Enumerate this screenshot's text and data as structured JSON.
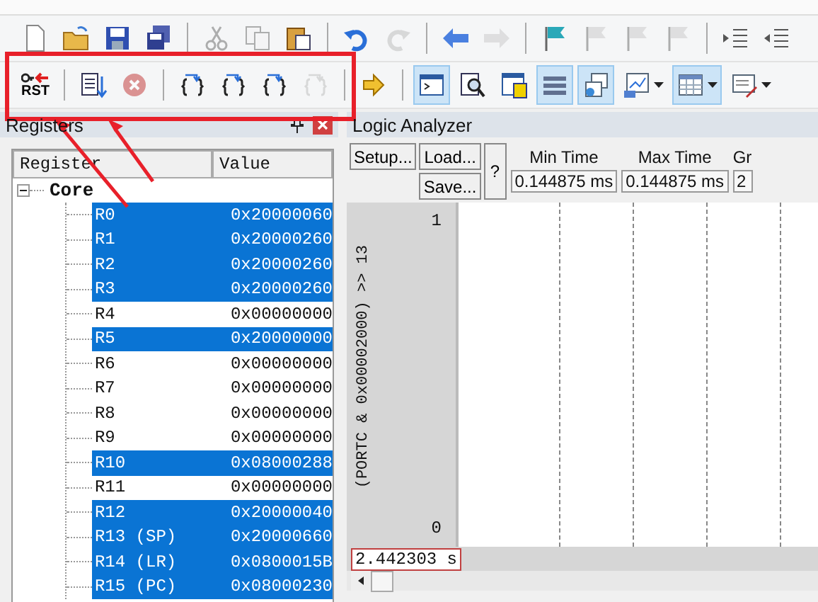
{
  "toolbar_rows": [
    [
      {
        "kind": "new",
        "disabled": false
      },
      {
        "kind": "open",
        "disabled": false
      },
      {
        "kind": "save",
        "disabled": false
      },
      {
        "kind": "saveall",
        "disabled": false
      },
      {
        "kind": "sep"
      },
      {
        "kind": "cut",
        "disabled": true
      },
      {
        "kind": "copy",
        "disabled": true
      },
      {
        "kind": "paste",
        "disabled": false
      },
      {
        "kind": "sep"
      },
      {
        "kind": "undo",
        "disabled": false
      },
      {
        "kind": "redo",
        "disabled": true
      },
      {
        "kind": "sep"
      },
      {
        "kind": "back",
        "disabled": false
      },
      {
        "kind": "forward",
        "disabled": true
      },
      {
        "kind": "sep"
      },
      {
        "kind": "flag",
        "disabled": false
      },
      {
        "kind": "flag",
        "disabled": true
      },
      {
        "kind": "flag",
        "disabled": true
      },
      {
        "kind": "flag",
        "disabled": true
      },
      {
        "kind": "sep"
      },
      {
        "kind": "indent",
        "disabled": false
      },
      {
        "kind": "outdent",
        "disabled": false
      }
    ],
    [
      {
        "kind": "rst",
        "label": "RST",
        "disabled": false
      },
      {
        "kind": "sep"
      },
      {
        "kind": "steplist",
        "disabled": false
      },
      {
        "kind": "stop",
        "disabled": true
      },
      {
        "kind": "sep"
      },
      {
        "kind": "braces",
        "disabled": false
      },
      {
        "kind": "braces",
        "disabled": false
      },
      {
        "kind": "braces",
        "disabled": false
      },
      {
        "kind": "braces",
        "disabled": true
      },
      {
        "kind": "sep"
      },
      {
        "kind": "arrow",
        "disabled": false
      },
      {
        "kind": "sep"
      },
      {
        "kind": "command",
        "disabled": false,
        "active": true
      },
      {
        "kind": "disasm",
        "disabled": false,
        "active": false
      },
      {
        "kind": "symbols",
        "disabled": false,
        "active": false
      },
      {
        "kind": "registers",
        "disabled": false,
        "active": true
      },
      {
        "kind": "callstack",
        "disabled": false,
        "active": true
      },
      {
        "kind": "watch",
        "disabled": false,
        "active": false,
        "dropdown": true
      },
      {
        "kind": "memory",
        "disabled": false,
        "active": true,
        "dropdown": true
      },
      {
        "kind": "serial",
        "disabled": false,
        "active": false,
        "dropdown": true
      }
    ]
  ],
  "registers": {
    "title": "Registers",
    "columns": [
      "Register",
      "Value"
    ],
    "group": {
      "name": "Core",
      "expanded": true,
      "children": [
        {
          "name": "R0",
          "value": "0x20000060",
          "selected": true
        },
        {
          "name": "R1",
          "value": "0x20000260",
          "selected": true
        },
        {
          "name": "R2",
          "value": "0x20000260",
          "selected": true
        },
        {
          "name": "R3",
          "value": "0x20000260",
          "selected": true
        },
        {
          "name": "R4",
          "value": "0x00000000",
          "selected": false
        },
        {
          "name": "R5",
          "value": "0x20000000",
          "selected": true
        },
        {
          "name": "R6",
          "value": "0x00000000",
          "selected": false
        },
        {
          "name": "R7",
          "value": "0x00000000",
          "selected": false
        },
        {
          "name": "R8",
          "value": "0x00000000",
          "selected": false
        },
        {
          "name": "R9",
          "value": "0x00000000",
          "selected": false
        },
        {
          "name": "R10",
          "value": "0x08000288",
          "selected": true
        },
        {
          "name": "R11",
          "value": "0x00000000",
          "selected": false
        },
        {
          "name": "R12",
          "value": "0x20000040",
          "selected": true
        },
        {
          "name": "R13 (SP)",
          "value": "0x20000660",
          "selected": true
        },
        {
          "name": "R14 (LR)",
          "value": "0x0800015B",
          "selected": true
        },
        {
          "name": "R15 (PC)",
          "value": "0x08000230",
          "selected": true
        }
      ]
    }
  },
  "logic_analyzer": {
    "title": "Logic Analyzer",
    "buttons": [
      "Setup...",
      "Load...",
      "Save...",
      "?"
    ],
    "fields": [
      {
        "label": "Min Time",
        "value": "0.144875 ms"
      },
      {
        "label": "Max Time",
        "value": "0.144875 ms"
      },
      {
        "label": "Gr",
        "value": "2"
      }
    ],
    "signal": {
      "name": "(PORTC & 0x00002000) >> 13",
      "max": "1",
      "min": "0"
    },
    "cursor_time": "2.442303 s"
  }
}
